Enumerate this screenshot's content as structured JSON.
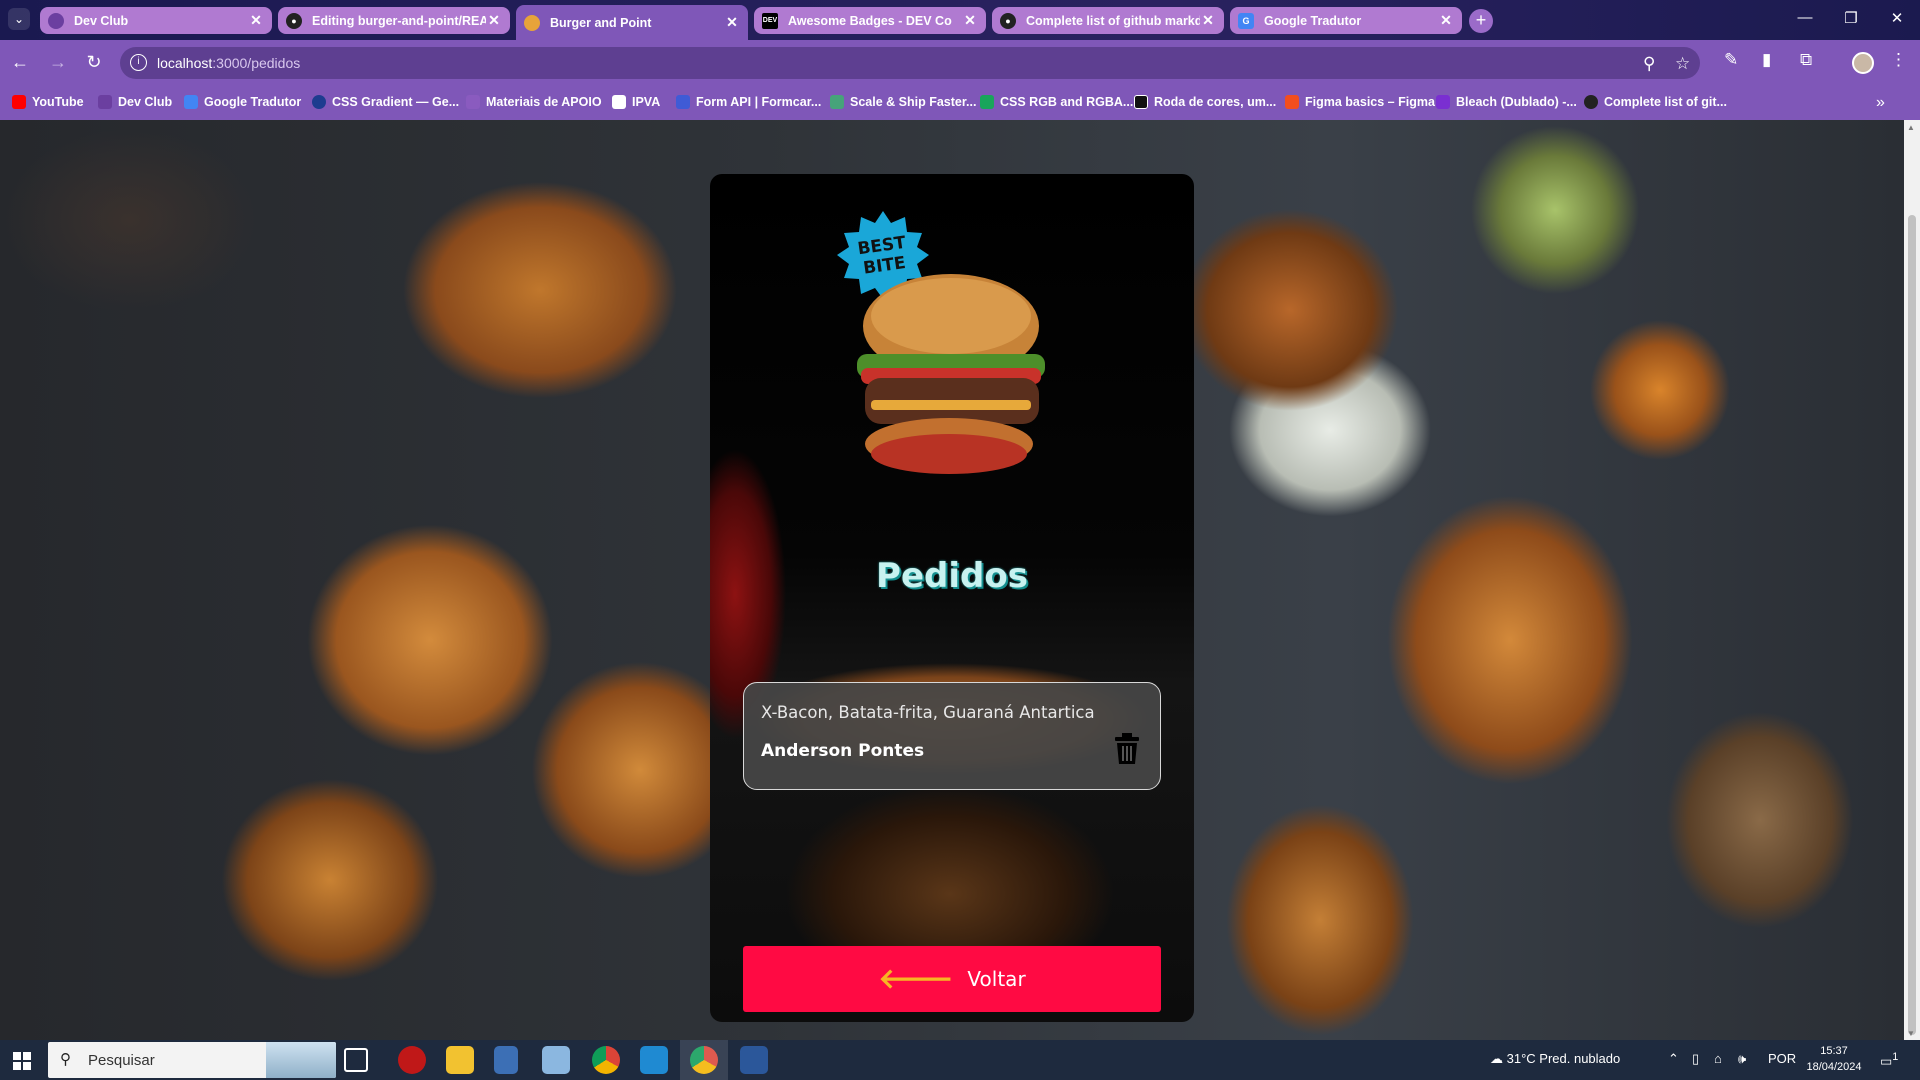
{
  "browser": {
    "tabs": [
      {
        "title": "Dev Club",
        "favicon_color": "#6b3fa0",
        "active": false
      },
      {
        "title": "Editing burger-and-point/REA",
        "favicon_color": "#222222",
        "active": false
      },
      {
        "title": "Burger and Point",
        "favicon_color": "#e7a33a",
        "active": true
      },
      {
        "title": "Awesome Badges - DEV Co",
        "favicon_color": "#000000",
        "active": false
      },
      {
        "title": "Complete list of github markd",
        "favicon_color": "#222222",
        "active": false
      },
      {
        "title": "Google Tradutor",
        "favicon_color": "#4285f4",
        "active": false
      }
    ],
    "url_host": "localhost",
    "url_path": ":3000/pedidos",
    "bookmarks": [
      {
        "label": "YouTube",
        "color": "#ff0000"
      },
      {
        "label": "Dev Club",
        "color": "#6b3fa0"
      },
      {
        "label": "Google Tradutor",
        "color": "#4285f4"
      },
      {
        "label": "CSS Gradient — Ge...",
        "color": "#1d3c8f"
      },
      {
        "label": "Materiais de APOIO",
        "color": "#8a5bbf"
      },
      {
        "label": "IPVA",
        "color": "#ffffff"
      },
      {
        "label": "Form API | Formcar...",
        "color": "#3f5bd6"
      },
      {
        "label": "Scale & Ship Faster...",
        "color": "#46a37a"
      },
      {
        "label": "CSS RGB and RGBA...",
        "color": "#19a55b"
      },
      {
        "label": "Roda de cores, um...",
        "color": "#111111"
      },
      {
        "label": "Figma basics – Figma",
        "color": "#f24e1e"
      },
      {
        "label": "Bleach (Dublado) -...",
        "color": "#7a2fd1"
      },
      {
        "label": "Complete list of git...",
        "color": "#222222"
      }
    ]
  },
  "card": {
    "badge_text": [
      "BEST",
      "BITE"
    ],
    "title": "Pedidos",
    "orders": [
      {
        "items": "X-Bacon, Batata-frita, Guaraná Antartica",
        "client": "Anderson Pontes"
      }
    ],
    "back_label": "Voltar",
    "back_arrow": "🡐"
  },
  "taskbar": {
    "search_placeholder": "Pesquisar",
    "weather": "31°C  Pred. nublado",
    "language": "POR",
    "time": "15:37",
    "date": "18/04/2024",
    "notifications": "1"
  },
  "colors": {
    "accent": "#7f57b8",
    "button": "#ff0a43",
    "title": "#c8f2f0",
    "taskbar": "#1e2a3e"
  }
}
